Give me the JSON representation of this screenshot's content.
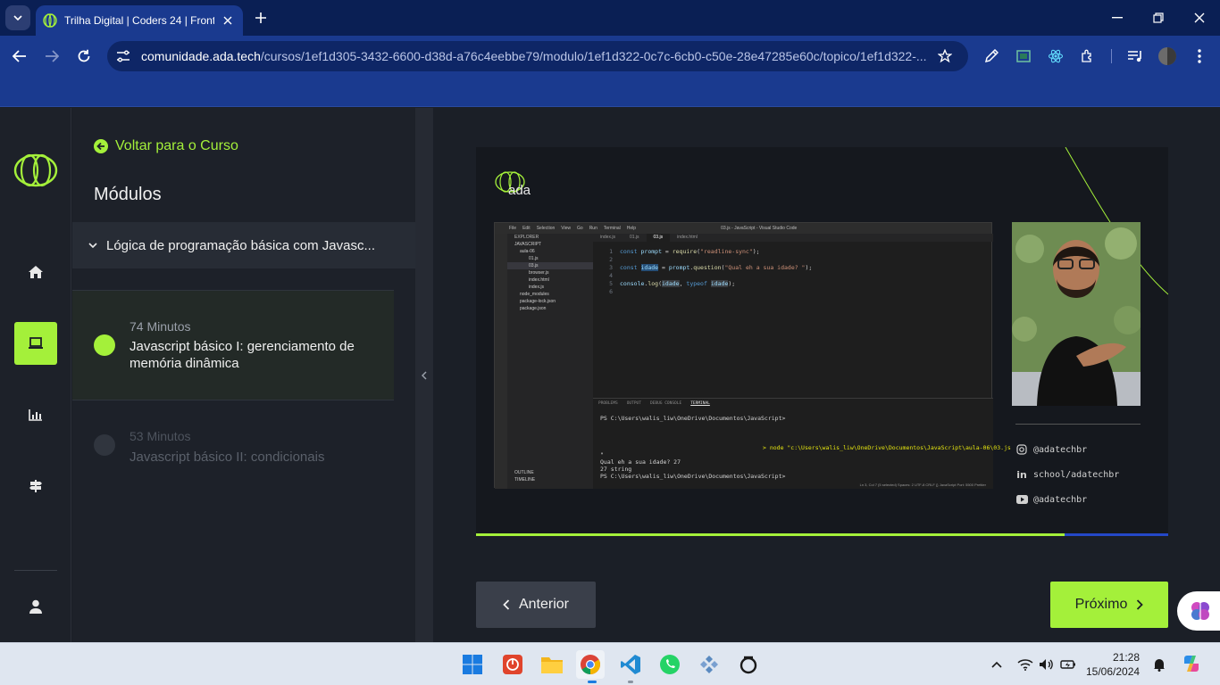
{
  "browser": {
    "tab_title": "Trilha Digital | Coders 24 | Front",
    "url_host": "comunidade.ada.tech",
    "url_path": "/cursos/1ef1d305-3432-6600-d38d-a76c4eebbe79/modulo/1ef1d322-0c7c-6cb0-c50e-28e47285e60c/topico/1ef1d322-..."
  },
  "sidebar": {
    "back_label": "Voltar para o Curso",
    "modules_heading": "Módulos",
    "module_title": "Lógica de programação básica com Javasc...",
    "lessons": [
      {
        "minutes": "74 Minutos",
        "title": "Javascript básico I: gerenciamento de memória dinâmica",
        "state": "current"
      },
      {
        "minutes": "53 Minutos",
        "title": "Javascript básico II: condicionais",
        "state": "locked"
      }
    ]
  },
  "video": {
    "logo_text": "ada",
    "progress": 0.85,
    "vscode": {
      "title": "03.js - JavaScript - Visual Studio Code",
      "menu": [
        "File",
        "Edit",
        "Selection",
        "View",
        "Go",
        "Run",
        "Terminal",
        "Help"
      ],
      "tabs": [
        "index.js",
        "01.js",
        "03.js",
        "index.html"
      ],
      "explorer": [
        "EXPLORER",
        "JAVASCRIPT",
        "aula-06",
        "01.js",
        "03.js",
        "browser.js",
        "index.html",
        "index.js",
        "node_modules",
        "package-lock.json",
        "package.json"
      ],
      "explorer_footer": [
        "OUTLINE",
        "TIMELINE"
      ],
      "code": [
        "const prompt = require(\"readline-sync\");",
        "",
        "const idade = prompt.question(\"Qual eh a sua idade? \");",
        "",
        "console.log(idade, typeof idade);",
        ""
      ],
      "terminal_tabs": [
        "PROBLEMS",
        "OUTPUT",
        "DEBUG CONSOLE",
        "TERMINAL"
      ],
      "terminal": [
        "PS C:\\Users\\walis_liw\\OneDrive\\Documentos\\JavaScript>",
        "> node \"c:\\Users\\walis_liw\\OneDrive\\Documentos\\JavaScript\\aula-06\\03.js",
        "\"",
        "Qual eh a sua idade? 27",
        "27 string",
        "PS C:\\Users\\walis_liw\\OneDrive\\Documentos\\JavaScript> "
      ],
      "status": "Ln 3, Col 7 (5 selected)   Spaces: 2   UTF-8   CRLF   {} JavaScript   Port: 5500   Prettier"
    },
    "socials": [
      {
        "icon": "instagram-icon",
        "label": "@adatechbr"
      },
      {
        "icon": "linkedin-icon",
        "label": "school/adatechbr"
      },
      {
        "icon": "youtube-icon",
        "label": "@adatechbr"
      }
    ]
  },
  "nav": {
    "prev_label": "Anterior",
    "next_label": "Próximo"
  },
  "taskbar": {
    "time": "21:28",
    "date": "15/06/2024"
  },
  "colors": {
    "accent": "#a4f03a",
    "chrome": "#1a3a8f",
    "panel": "#1d2129"
  }
}
